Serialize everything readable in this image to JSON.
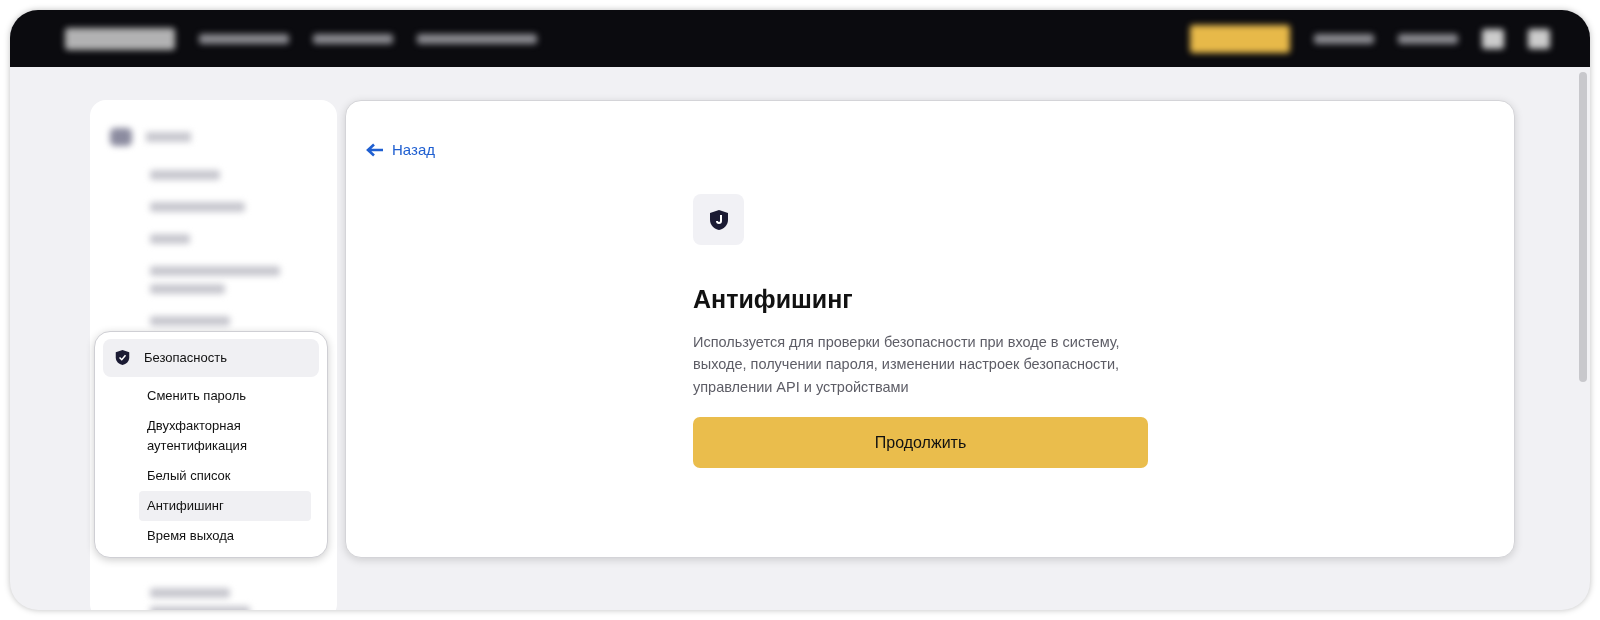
{
  "back_link": "Назад",
  "feature": {
    "title": "Антифишинг",
    "description": "Используется для проверки безопасности при входе в систему, выходе, получении пароля, изменении настроек безопасности, управлении API и устройствами",
    "button": "Продолжить"
  },
  "security_menu": {
    "section": {
      "label": "Безопасность",
      "selected": true
    },
    "items": [
      {
        "label": "Сменить пароль",
        "selected": false
      },
      {
        "label": "Двухфакторная аутентификация",
        "selected": false
      },
      {
        "label": "Белый список",
        "selected": false
      },
      {
        "label": "Антифишинг",
        "selected": true
      },
      {
        "label": "Время выхода",
        "selected": false
      }
    ]
  }
}
